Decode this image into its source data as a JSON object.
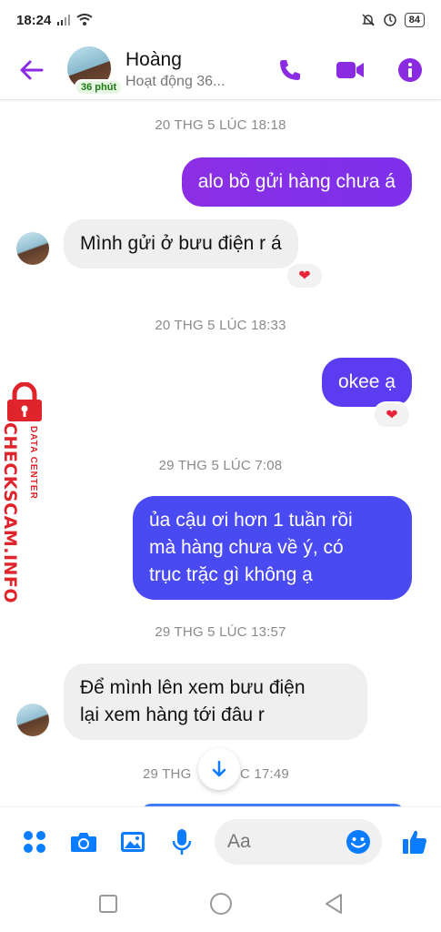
{
  "status_bar": {
    "time": "18:24",
    "battery": "84"
  },
  "header": {
    "contact_name": "Hoàng",
    "active_badge": "36 phút",
    "status_text": "Hoạt động 36..."
  },
  "messages": [
    {
      "timestamp": "20 THG 5 LÚC 18:18"
    },
    {
      "direction": "out",
      "text": "alo bồ gửi hàng chưa á"
    },
    {
      "direction": "in",
      "text": "Mình gửi ở bưu điện r á",
      "reaction": "heart"
    },
    {
      "timestamp": "20 THG 5 LÚC 18:33"
    },
    {
      "direction": "out",
      "text": "okee ạ",
      "reaction": "heart"
    },
    {
      "timestamp": "29 THG 5 LÚC 7:08"
    },
    {
      "direction": "out",
      "lines": [
        "ủa cậu ơi hơn 1 tuần rồi",
        "mà hàng chưa về ý, có",
        "trục trặc gì không ạ"
      ]
    },
    {
      "timestamp": "29 THG 5 LÚC 13:57"
    },
    {
      "direction": "in",
      "lines": [
        "Để mình lên xem bưu điện",
        "lại xem hàng tới đâu r"
      ]
    },
    {
      "timestamp_left": "29 THG",
      "timestamp_right": "C 17:49"
    }
  ],
  "watermark": {
    "brand": "CHECKSCAM.INFO",
    "sub": "DATA CENTER"
  },
  "composer": {
    "placeholder": "Aa"
  },
  "colors": {
    "accent": "#8a2be2",
    "messenger_blue": "#0a7cff",
    "bubble_purple": "#8b2fe6",
    "bubble_indigo": "#5b3cf0",
    "bubble_blue": "#4a4af2",
    "bubble_in": "#efefef"
  }
}
